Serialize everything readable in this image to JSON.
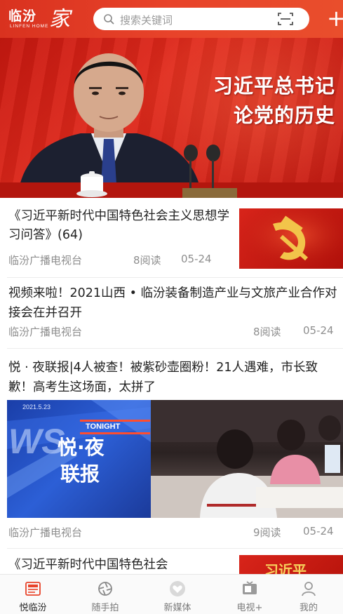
{
  "header": {
    "logo_cn": "临汾",
    "logo_mark": "家",
    "logo_en": "LINFEN HOME",
    "search_placeholder": "搜索关键词",
    "icons": [
      "search-icon",
      "scan-icon",
      "plus-icon"
    ]
  },
  "banner": {
    "headline_line1": "习近平总书记",
    "headline_line2": "论党的历史"
  },
  "news": [
    {
      "title": "《习近平新时代中国特色社会主义思想学习问答》(64)",
      "source": "临汾广播电视台",
      "reads": "8阅读",
      "date": "05-24"
    },
    {
      "title": "视频来啦！2021山西 • 临汾装备制造产业与文旅产业合作对接会在并召开",
      "source": "临汾广播电视台",
      "reads": "8阅读",
      "date": "05-24"
    },
    {
      "title": "悦 · 夜联报|4人被查！被紫砂壶圈粉！21人遇难，市长致歉！高考生这场面，太拼了",
      "image_date": "2021.5.23",
      "image_tonight": "TONIGHT",
      "image_brand_top": "悦·夜",
      "image_brand_bottom": "联报",
      "image_ws": "WS",
      "source": "临汾广播电视台",
      "reads": "9阅读",
      "date": "05-24"
    },
    {
      "title": "《习近平新时代中国特色社会",
      "thumb_text": "习近平"
    }
  ],
  "tabs": [
    {
      "label": "悦临汾",
      "icon": "news-icon",
      "active": true
    },
    {
      "label": "随手拍",
      "icon": "camera-shutter-icon",
      "active": false
    },
    {
      "label": "新媒体",
      "icon": "heart-badge-icon",
      "active": false
    },
    {
      "label": "电视+",
      "icon": "tv-icon",
      "active": false
    },
    {
      "label": "我的",
      "icon": "user-icon",
      "active": false
    }
  ],
  "colors": {
    "brand_red": "#e8432a",
    "active_tab_icon": "#e8432a",
    "meta_gray": "#8e8e8e"
  }
}
